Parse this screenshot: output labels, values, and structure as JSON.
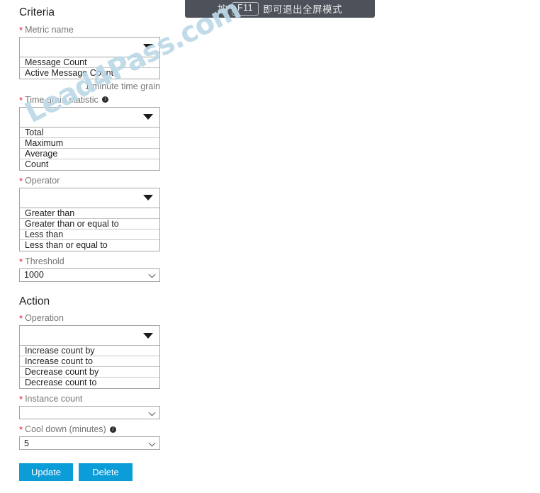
{
  "banner": {
    "prefix": "按",
    "key": "F11",
    "suffix": "即可退出全屏模式"
  },
  "watermark": {
    "text": "Lead4Pass.com"
  },
  "criteria": {
    "title": "Criteria",
    "metric_name": {
      "label": "Metric name",
      "value": "",
      "options": [
        "Message Count",
        "Active Message Count"
      ],
      "hint": "1 minute time grain"
    },
    "time_grain_statistic": {
      "label": "Time grain statistic",
      "value": "",
      "options": [
        "Total",
        "Maximum",
        "Average",
        "Count"
      ]
    },
    "operator": {
      "label": "Operator",
      "value": "",
      "options": [
        "Greater than",
        "Greater than or equal to",
        "Less than",
        "Less than or equal to"
      ]
    },
    "threshold": {
      "label": "Threshold",
      "value": "1000"
    }
  },
  "action": {
    "title": "Action",
    "operation": {
      "label": "Operation",
      "value": "",
      "options": [
        "Increase count by",
        "Increase count to",
        "Decrease count by",
        "Decrease count to"
      ]
    },
    "instance_count": {
      "label": "Instance count",
      "value": ""
    },
    "cool_down": {
      "label": "Cool down (minutes)",
      "value": "5"
    }
  },
  "buttons": {
    "update": "Update",
    "delete": "Delete"
  },
  "colors": {
    "accent": "#0c9cd8",
    "required": "#e81123",
    "banner_bg": "#4d525a",
    "watermark": "#bcd8e8"
  }
}
